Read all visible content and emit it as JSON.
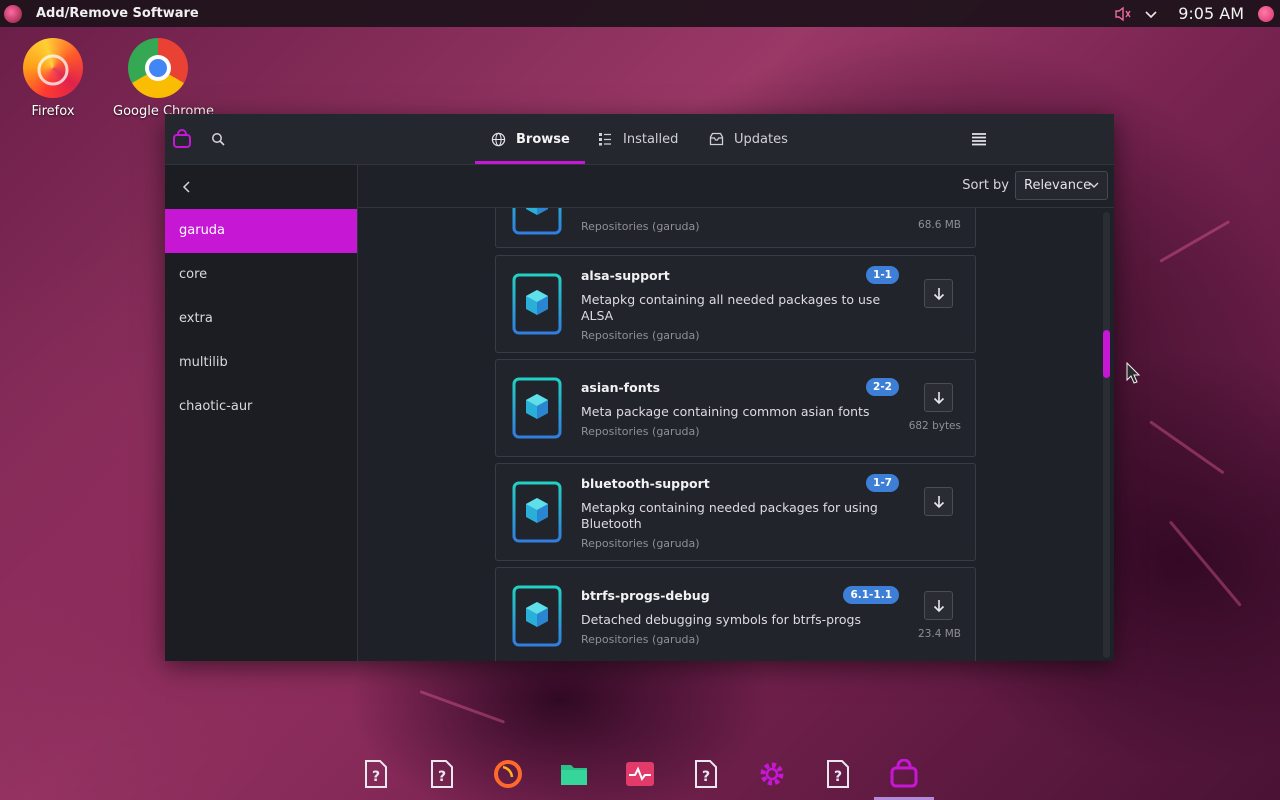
{
  "topbar": {
    "app_title": "Add/Remove Software",
    "clock": "9:05 AM",
    "icons": [
      "garuda-logo-icon",
      "volume-muted-icon",
      "chevron-down-icon",
      "avatar"
    ]
  },
  "desktop": {
    "icons": [
      {
        "label": "Firefox",
        "icon": "firefox-icon"
      },
      {
        "label": "Google Chrome",
        "icon": "chrome-icon"
      }
    ]
  },
  "window": {
    "tabs": [
      {
        "label": "Browse",
        "icon": "globe-icon",
        "active": true
      },
      {
        "label": "Installed",
        "icon": "list-icon",
        "active": false
      },
      {
        "label": "Updates",
        "icon": "inbox-icon",
        "active": false
      }
    ],
    "sort": {
      "label": "Sort by",
      "value": "Relevance"
    },
    "sidebar": {
      "items": [
        {
          "label": "garuda",
          "active": true
        },
        {
          "label": "core",
          "active": false
        },
        {
          "label": "extra",
          "active": false
        },
        {
          "label": "multilib",
          "active": false
        },
        {
          "label": "chaotic-aur",
          "active": false
        }
      ]
    },
    "packages": [
      {
        "name": "",
        "version": "",
        "description": "",
        "repo": "Repositories (garuda)",
        "size": "68.6 MB"
      },
      {
        "name": "alsa-support",
        "version": "1-1",
        "description": "Metapkg containing all needed packages to use ALSA",
        "repo": "Repositories (garuda)",
        "size": ""
      },
      {
        "name": "asian-fonts",
        "version": "2-2",
        "description": "Meta package containing common asian fonts",
        "repo": "Repositories (garuda)",
        "size": "682 bytes"
      },
      {
        "name": "bluetooth-support",
        "version": "1-7",
        "description": "Metapkg containing needed packages for using Bluetooth",
        "repo": "Repositories (garuda)",
        "size": ""
      },
      {
        "name": "btrfs-progs-debug",
        "version": "6.1-1.1",
        "description": "Detached debugging symbols for btrfs-progs",
        "repo": "Repositories (garuda)",
        "size": "23.4 MB"
      }
    ],
    "scroll_position": 0.27
  },
  "dock": {
    "items": [
      "unknown-app-icon",
      "unknown-app-icon",
      "firedragon-icon",
      "files-icon",
      "system-monitor-icon",
      "unknown-app-icon",
      "settings-gear-icon",
      "unknown-app-icon",
      "software-bag-icon"
    ]
  },
  "colors": {
    "accent": "#c517d4",
    "badge": "#3d7fd6",
    "window_bg": "#1f2128"
  }
}
